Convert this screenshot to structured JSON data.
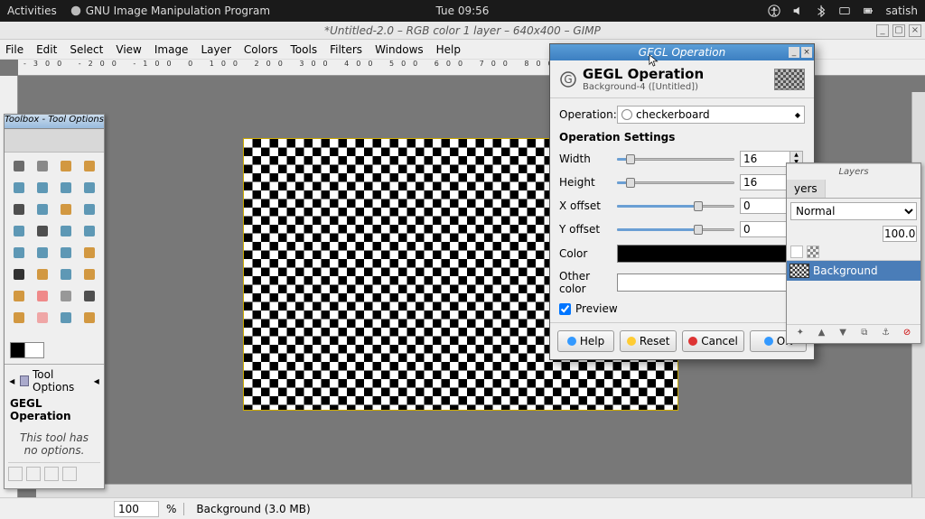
{
  "topbar": {
    "activities": "Activities",
    "app_label": "GNU Image Manipulation Program",
    "clock": "Tue 09:56",
    "user": "satish"
  },
  "window": {
    "title": "*Untitled-2.0 – RGB color 1 layer – 640x400 – GIMP"
  },
  "menu": {
    "items": [
      "File",
      "Edit",
      "Select",
      "View",
      "Image",
      "Layer",
      "Colors",
      "Tools",
      "Filters",
      "Windows",
      "Help"
    ]
  },
  "toolbox": {
    "title": "Toolbox - Tool Options"
  },
  "tool_options": {
    "header": "Tool Options",
    "title": "GEGL Operation",
    "hint1": "This tool has",
    "hint2": "no options."
  },
  "ruler": {
    "marks": "   -300     -200     -100      0       100      200      300      400      500      600      700      800      900"
  },
  "dialog": {
    "win_title": "GEGL Operation",
    "title": "GEGL Operation",
    "subtitle": "Background-4 ([Untitled])",
    "operation_label": "Operation:",
    "operation_value": "checkerboard",
    "settings_header": "Operation Settings",
    "fields": {
      "width": {
        "label": "Width",
        "value": "16",
        "fill": 8
      },
      "height": {
        "label": "Height",
        "value": "16",
        "fill": 8
      },
      "xoffset": {
        "label": "X offset",
        "value": "0",
        "fill": 65
      },
      "yoffset": {
        "label": "Y offset",
        "value": "0",
        "fill": 65
      }
    },
    "color_label": "Color",
    "other_color_label": "Other color",
    "preview_label": "Preview",
    "buttons": {
      "help": "Help",
      "reset": "Reset",
      "cancel": "Cancel",
      "ok": "OK"
    }
  },
  "layers": {
    "title": "Layers",
    "tab": "yers",
    "mode": "Normal",
    "opacity": "100.0",
    "layer_name": "Background"
  },
  "footer": {
    "zoom": "100",
    "zoom_suffix": "%",
    "status": "Background (3.0 MB)"
  }
}
